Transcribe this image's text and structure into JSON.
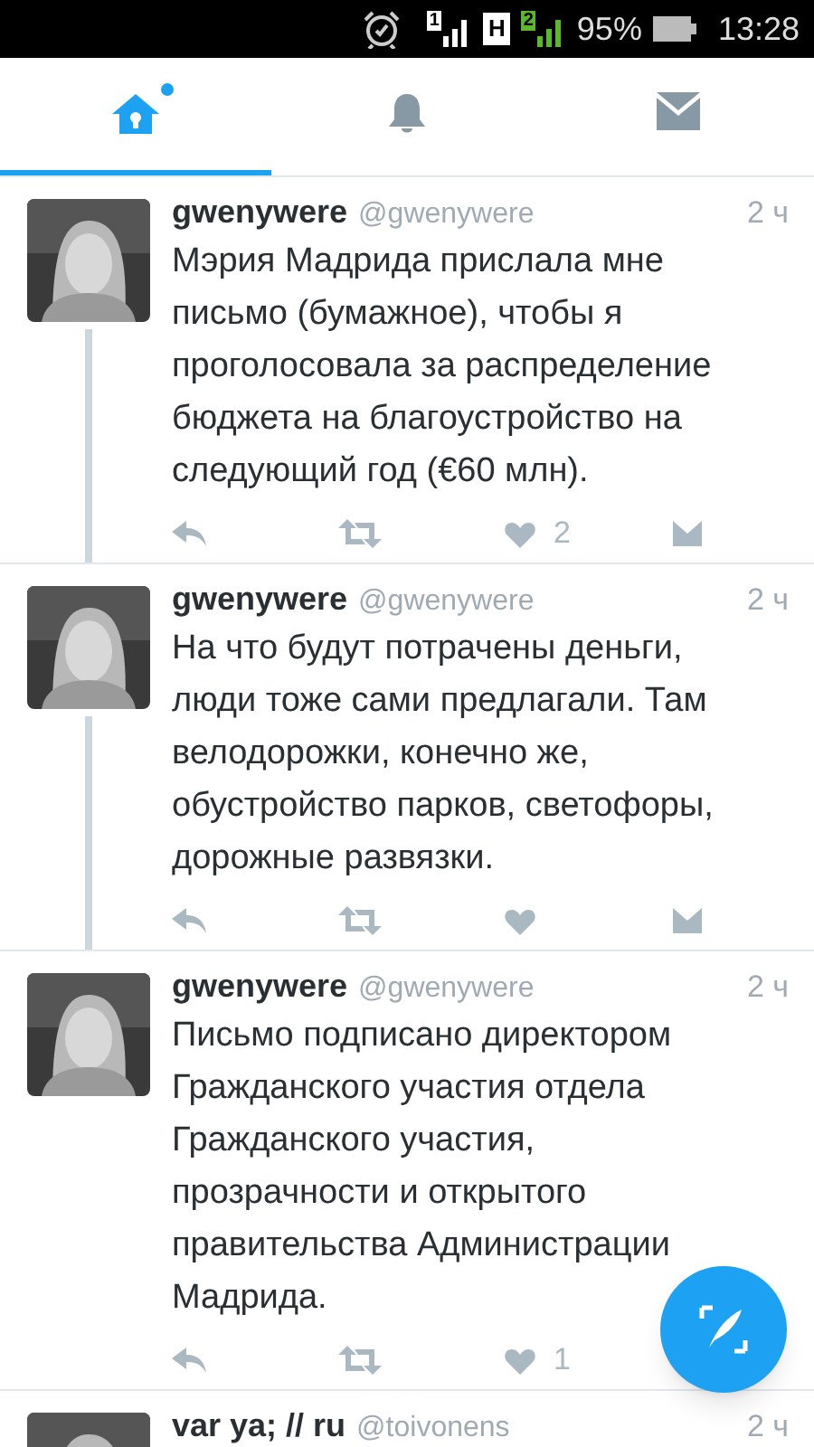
{
  "status_bar": {
    "sim1": "1",
    "network": "H",
    "sim2": "2",
    "battery_percent": "95%",
    "time": "13:28"
  },
  "tabs": [
    {
      "kind": "home",
      "selected": true,
      "badge": true
    },
    {
      "kind": "notifications",
      "selected": false,
      "badge": false
    },
    {
      "kind": "messages",
      "selected": false,
      "badge": false
    }
  ],
  "tweets": [
    {
      "name": "gwenywere",
      "handle": "@gwenywere",
      "time": "2 ч",
      "text": "Мэрия Мадрида прислала мне письмо (бумажное), чтобы я проголосовала за распределение бюджета на благоустройство на следующий год (€60 млн).",
      "thread": true,
      "actions": [
        {
          "kind": "reply"
        },
        {
          "kind": "retweet"
        },
        {
          "kind": "like",
          "count": "2"
        },
        {
          "kind": "dm"
        }
      ]
    },
    {
      "name": "gwenywere",
      "handle": "@gwenywere",
      "time": "2 ч",
      "text": "На что будут потрачены деньги, люди тоже сами предлагали. Там велодорожки, конечно же, обустройство парков, светофоры, дорожные развязки.",
      "thread": true,
      "actions": [
        {
          "kind": "reply"
        },
        {
          "kind": "retweet"
        },
        {
          "kind": "like"
        },
        {
          "kind": "dm"
        }
      ]
    },
    {
      "name": "gwenywere",
      "handle": "@gwenywere",
      "time": "2 ч",
      "text": "Письмо подписано директором Гражданского участия отдела Гражданского участия, прозрачности и открытого правительства Администрации Мадрида.",
      "thread": false,
      "actions": [
        {
          "kind": "reply"
        },
        {
          "kind": "retweet"
        },
        {
          "kind": "like",
          "count": "1"
        }
      ]
    },
    {
      "name": "var ya; // ru",
      "handle": "@toivonens",
      "time": "2 ч",
      "thread": false
    }
  ]
}
